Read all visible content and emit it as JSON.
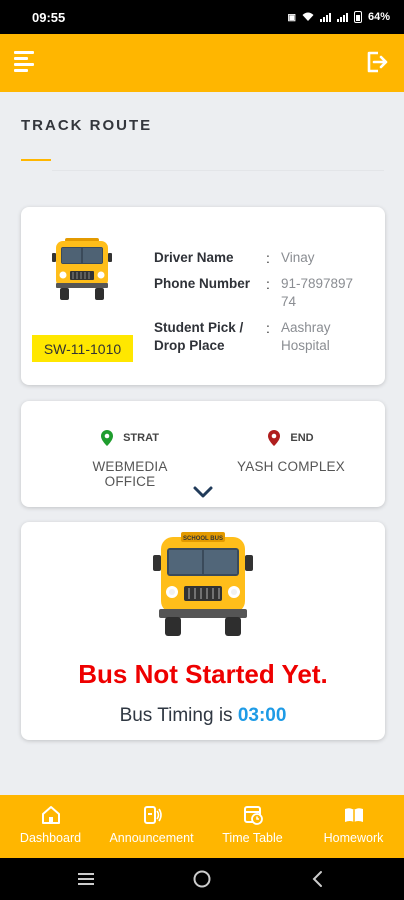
{
  "status_bar": {
    "time": "09:55",
    "battery": "64%"
  },
  "header": {
    "title": "TRACK ROUTE"
  },
  "driver": {
    "plate": "SW-11-1010",
    "rows": [
      {
        "label": "Driver Name",
        "value": "Vinay"
      },
      {
        "label": "Phone Number",
        "value": "91-789789774"
      },
      {
        "label": "Student Pick / Drop Place",
        "value": "Aashray Hospital"
      }
    ]
  },
  "route": {
    "start_label": "STRAT",
    "start_place": "WEBMEDIA OFFICE",
    "end_label": "END",
    "end_place": "YASH COMPLEX",
    "start_pin_color": "#1f9d2e",
    "end_pin_color": "#b01e1e"
  },
  "bus_status": {
    "message": "Bus Not Started Yet.",
    "timing_prefix": "Bus Timing is ",
    "timing_value": "03:00",
    "bus_sign": "SCHOOL BUS"
  },
  "bottom_nav": [
    {
      "label": "Dashboard",
      "icon": "home-icon"
    },
    {
      "label": "Announcement",
      "icon": "megaphone-icon"
    },
    {
      "label": "Time Table",
      "icon": "calendar-clock-icon"
    },
    {
      "label": "Homework",
      "icon": "book-icon"
    }
  ],
  "colors": {
    "accent": "#ffb600",
    "alert": "#ee0000",
    "timing": "#1e9be6",
    "plate_bg": "#ffe700"
  }
}
